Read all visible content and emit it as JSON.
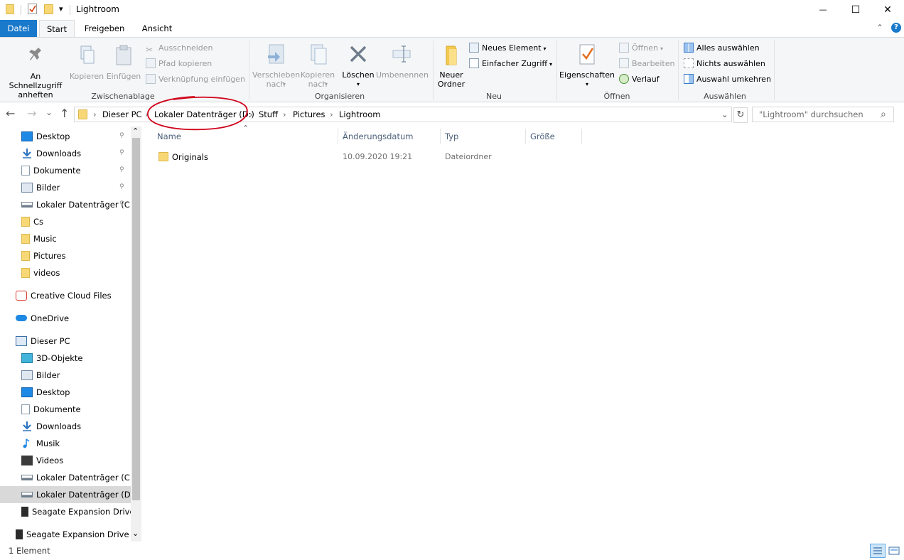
{
  "window": {
    "title": "Lightroom",
    "minimize_glyph": "—",
    "maximize_glyph": "☐",
    "close_glyph": "✕"
  },
  "qat": {
    "dropdown_glyph": "▾"
  },
  "tabs": {
    "file": "Datei",
    "start": "Start",
    "share": "Freigeben",
    "view": "Ansicht",
    "collapse_glyph": "⌃",
    "help_glyph": "?"
  },
  "ribbon": {
    "clipboard": {
      "label": "Zwischenablage",
      "pin_line1": "An Schnellzugriff",
      "pin_line2": "anheften",
      "copy": "Kopieren",
      "paste": "Einfügen",
      "cut": "Ausschneiden",
      "copy_path": "Pfad kopieren",
      "paste_shortcut": "Verknüpfung einfügen"
    },
    "organize": {
      "label": "Organisieren",
      "move_line1": "Verschieben",
      "move_line2": "nach",
      "copyto_line1": "Kopieren",
      "copyto_line2": "nach",
      "delete": "Löschen",
      "rename": "Umbenennen"
    },
    "new": {
      "label": "Neu",
      "folder_line1": "Neuer",
      "folder_line2": "Ordner",
      "new_item": "Neues Element",
      "easy_access": "Einfacher Zugriff"
    },
    "open": {
      "label": "Öffnen",
      "properties": "Eigenschaften",
      "open": "Öffnen",
      "edit": "Bearbeiten",
      "history": "Verlauf"
    },
    "select": {
      "label": "Auswählen",
      "select_all": "Alles auswählen",
      "select_none": "Nichts auswählen",
      "invert": "Auswahl umkehren"
    }
  },
  "address": {
    "back": "←",
    "forward": "→",
    "recent": "⌄",
    "up": "↑",
    "crumbs": [
      "Dieser PC",
      "Lokaler Datenträger (D:)",
      "Stuff",
      "Pictures",
      "Lightroom"
    ],
    "separator": "›",
    "dropdown": "⌄",
    "refresh": "↻",
    "search_placeholder": "\"Lightroom\" durchsuchen",
    "search_glyph": "⌕"
  },
  "annotation": {
    "color": "#d0021b"
  },
  "nav": {
    "quick_access": [
      {
        "label": "Desktop",
        "pinned": true
      },
      {
        "label": "Downloads",
        "pinned": true
      },
      {
        "label": "Dokumente",
        "pinned": true
      },
      {
        "label": "Bilder",
        "pinned": true
      },
      {
        "label": "Lokaler Datenträger (C",
        "pinned": true
      },
      {
        "label": "Cs",
        "pinned": false
      },
      {
        "label": "Music",
        "pinned": false
      },
      {
        "label": "Pictures",
        "pinned": false
      },
      {
        "label": "videos",
        "pinned": false
      }
    ],
    "creative_cloud": "Creative Cloud Files",
    "onedrive": "OneDrive",
    "this_pc": "Dieser PC",
    "this_pc_items": [
      "3D-Objekte",
      "Bilder",
      "Desktop",
      "Dokumente",
      "Downloads",
      "Musik",
      "Videos",
      "Lokaler Datenträger (C:)",
      "Lokaler Datenträger (D:)",
      "Seagate Expansion Drive"
    ],
    "external": "Seagate Expansion Drive (E",
    "pin_glyph": "📌",
    "scroll_up": "⌃",
    "scroll_down": "⌄"
  },
  "list": {
    "columns": {
      "name": "Name",
      "date": "Änderungsdatum",
      "type": "Typ",
      "size": "Größe"
    },
    "sort_glyph": "⌃",
    "rows": [
      {
        "name": "Originals",
        "date": "10.09.2020 19:21",
        "type": "Dateiordner",
        "size": ""
      }
    ]
  },
  "status": {
    "count": "1 Element"
  }
}
